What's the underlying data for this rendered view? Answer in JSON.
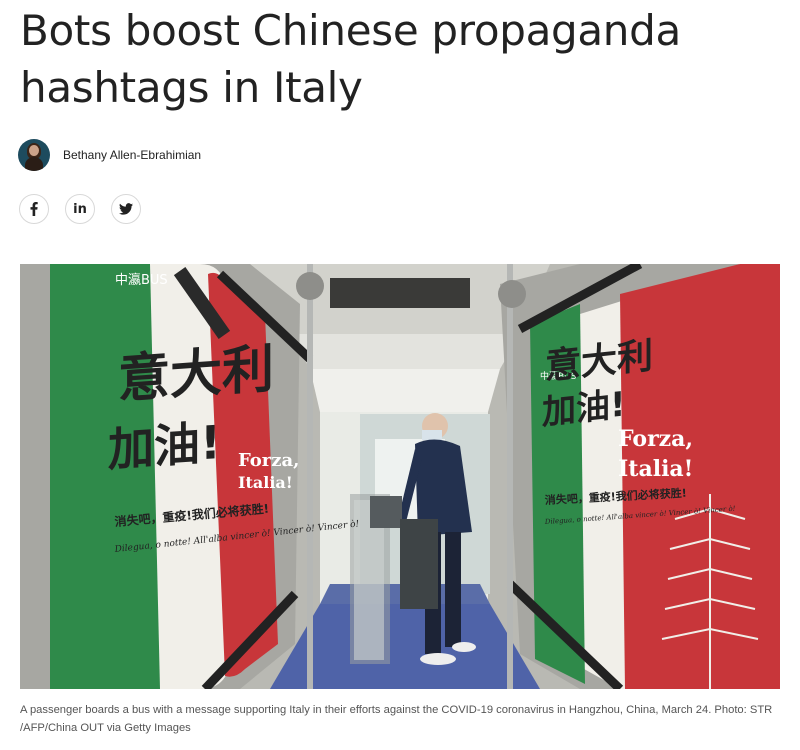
{
  "article": {
    "headline_line1": "Bots boost Chinese propaganda",
    "headline_line2": "hashtags in Italy",
    "author": "Bethany Allen-Ebrahimian",
    "share_icons": [
      "facebook-icon",
      "linkedin-icon",
      "twitter-icon"
    ],
    "share_labels": {
      "linkedin": "in"
    },
    "caption": "A passenger boards a bus with a message supporting Italy in their efforts against the COVID-19 coronavirus in Hangzhou, China, March 24. Photo: STR /AFP/China OUT via Getty Images"
  },
  "photo": {
    "ad_logo": "中瀛BUS",
    "ad_line1": "意大利",
    "ad_line2": "加油!",
    "ad_forza": "Forza,",
    "ad_italia": "Italia!",
    "ad_small_cn_left": "消失吧，重疫!我们必将获胜!",
    "ad_small_cn_right": "消失吧，重疫!我们必将获胜!",
    "ad_small_it": "Dilegua, o notte! All'alba vincer ò! Vincer ò! Vincer ò!",
    "colors": {
      "green": "#2f8a4a",
      "white": "#f1efe9",
      "red": "#c8363a"
    }
  }
}
